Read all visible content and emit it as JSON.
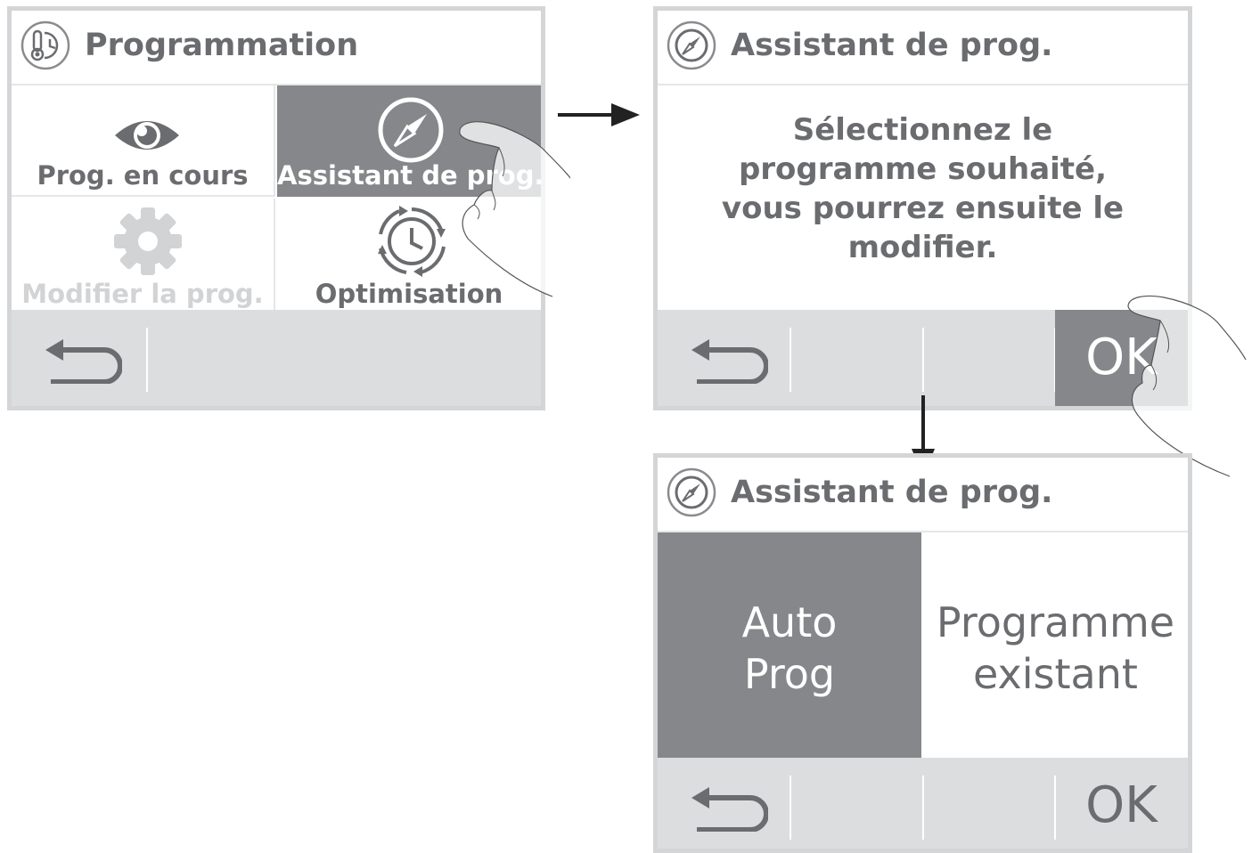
{
  "screen1": {
    "title": "Programmation",
    "tiles": [
      {
        "label": "Prog. en cours",
        "icon": "eye-icon"
      },
      {
        "label": "Assistant de prog.",
        "icon": "compass-icon"
      },
      {
        "label": "Modifier la prog.",
        "icon": "gear-icon"
      },
      {
        "label": "Optimisation",
        "icon": "clock-cycle-icon"
      }
    ]
  },
  "screen2": {
    "title": "Assistant de prog.",
    "message_lines": [
      "Sélectionnez le",
      "programme souhaité,",
      "vous pourrez ensuite le",
      "modifier."
    ],
    "ok_label": "OK"
  },
  "screen3": {
    "title": "Assistant de prog.",
    "option_auto": [
      "Auto",
      "Prog"
    ],
    "option_existing": [
      "Programme",
      "existant"
    ],
    "ok_label": "OK"
  },
  "colors": {
    "selected_tile": "#85878a",
    "bottom_bar": "#dcdddf",
    "border": "#d4d5d7",
    "text": "#6b6c6f",
    "disabled_text": "#d2d3d5"
  }
}
